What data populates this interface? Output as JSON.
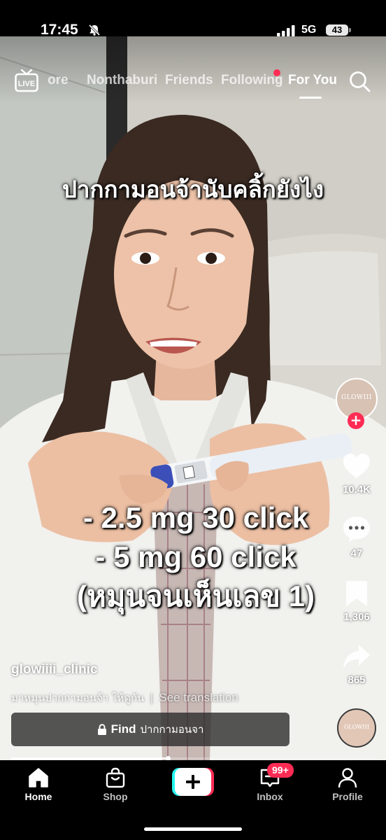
{
  "status_bar": {
    "time": "17:45",
    "network": "5G",
    "battery": "43"
  },
  "top_nav": {
    "live_icon": "live-tv-icon",
    "tabs": [
      {
        "label": "ore",
        "active": false
      },
      {
        "label": "Nonthaburi",
        "active": false
      },
      {
        "label": "Friends",
        "active": false
      },
      {
        "label": "Following",
        "active": false,
        "dot": true
      },
      {
        "label": "For You",
        "active": true
      }
    ],
    "search_icon": "search-icon"
  },
  "video": {
    "caption_top": "ปากกามอนจ้านับคลิ้กยังไง",
    "caption_lines": [
      "- 2.5 mg 30 click",
      "- 5 mg 60 click",
      "(หมุนจนเห็นเลข 1)"
    ]
  },
  "actions": {
    "avatar_text": "GLOWIII",
    "likes": "10.4K",
    "comments": "47",
    "saves": "1,306",
    "shares": "865",
    "disc_text": "GLOWIII"
  },
  "info": {
    "username": "glowiiii_clinic",
    "description": "มาหมุนปากกามอนจ้า ให้ดูกัน",
    "see_translation": "See translation",
    "find_label": "Find",
    "find_query": "ปากกามอนจา",
    "progress": 0.43
  },
  "bottom_nav": {
    "items": [
      {
        "label": "Home",
        "active": true
      },
      {
        "label": "Shop",
        "active": false
      },
      {
        "label": "Inbox",
        "active": false
      },
      {
        "label": "Profile",
        "active": false
      }
    ],
    "inbox_badge": "99+"
  },
  "colors": {
    "accent": "#fe2c55",
    "create_cyan": "#25f4ee",
    "background": "#000000"
  }
}
